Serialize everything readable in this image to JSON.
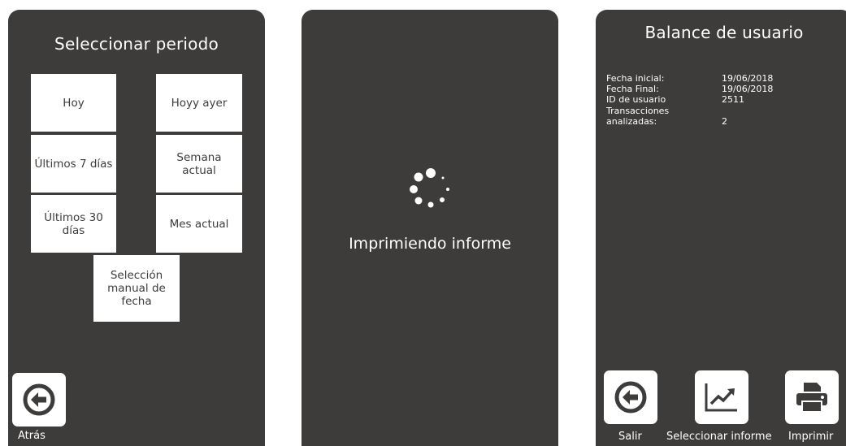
{
  "period_screen": {
    "title": "Seleccionar periodo",
    "options": [
      "Hoy",
      "Hoyy ayer",
      "Últimos 7 días",
      "Semana\nactual",
      "Últimos 30\ndías",
      "Mes actual",
      "Selección\nmanual de\nfecha"
    ],
    "back_label": "Atrás",
    "back_icon": "arrow-left-circle-icon"
  },
  "printing_screen": {
    "message": "Imprimiendo informe",
    "spinner_icon": "loading-spinner-icon"
  },
  "balance_screen": {
    "title": "Balance de usuario",
    "rows": [
      {
        "label": "Fecha inicial:",
        "value": "19/06/2018"
      },
      {
        "label": "Fecha Final:",
        "value": "19/06/2018"
      },
      {
        "label": "ID de usuario",
        "value": "2511"
      },
      {
        "label": "Transacciones\nanalizadas:",
        "value": "2"
      }
    ],
    "buttons": [
      {
        "label": "Salir",
        "icon": "arrow-left-circle-icon"
      },
      {
        "label": "Seleccionar informe",
        "icon": "line-chart-icon"
      },
      {
        "label": "Imprimir",
        "icon": "printer-icon"
      }
    ]
  },
  "colors": {
    "panel_background": "#3d3c3b",
    "tile_background": "#ffffff",
    "text_light": "#ffffff",
    "text_dark": "#3d3c3b"
  }
}
